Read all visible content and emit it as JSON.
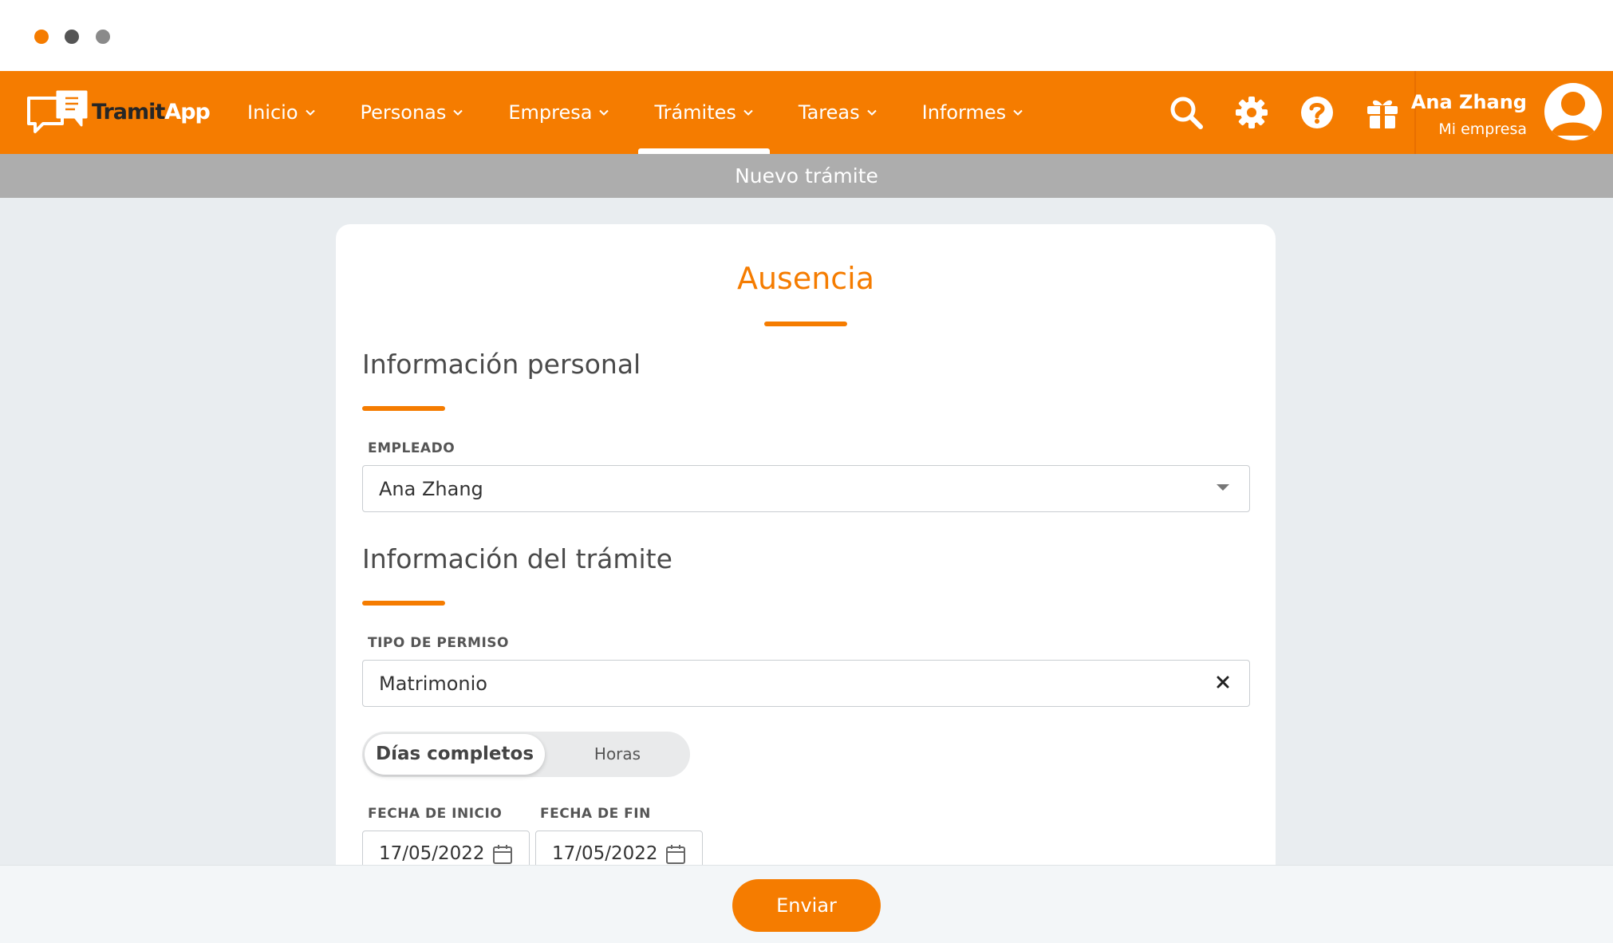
{
  "window": {
    "dots": [
      "orange",
      "dark-gray",
      "gray"
    ]
  },
  "brand": {
    "name_part1": "Tramit",
    "name_part2": "App",
    "accent": "#f57c00"
  },
  "nav": {
    "items": [
      {
        "label": "Inicio",
        "active": false
      },
      {
        "label": "Personas",
        "active": false
      },
      {
        "label": "Empresa",
        "active": false
      },
      {
        "label": "Trámites",
        "active": true
      },
      {
        "label": "Tareas",
        "active": false
      },
      {
        "label": "Informes",
        "active": false
      }
    ],
    "icons": [
      "search-icon",
      "gear-icon",
      "help-icon",
      "gift-icon"
    ]
  },
  "user": {
    "name": "Ana Zhang",
    "company": "Mi empresa"
  },
  "subheader": {
    "title": "Nuevo trámite"
  },
  "form": {
    "title": "Ausencia",
    "section_personal": "Información personal",
    "employee_label": "EMPLEADO",
    "employee_value": "Ana Zhang",
    "section_tramite": "Información del trámite",
    "permission_label": "TIPO DE PERMISO",
    "permission_value": "Matrimonio",
    "toggle": {
      "full_days": "Días completos",
      "hours": "Horas",
      "selected": "Días completos"
    },
    "start_label": "FECHA DE INICIO",
    "start_value": "17/05/2022",
    "end_label": "FECHA DE FIN",
    "end_value": "17/05/2022"
  },
  "footer": {
    "submit_label": "Enviar"
  }
}
